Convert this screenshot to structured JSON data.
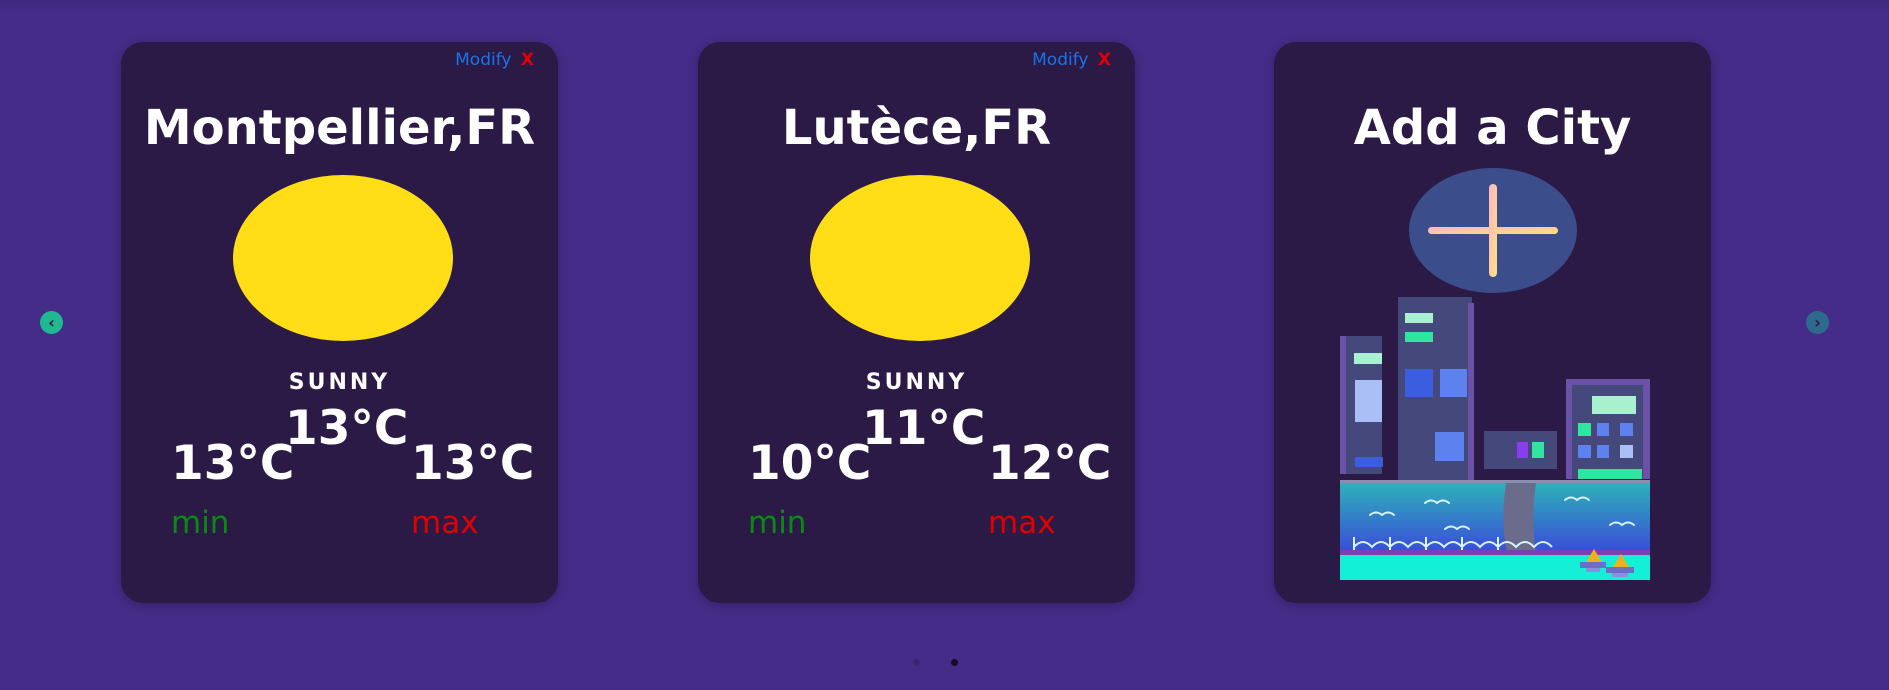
{
  "carousel": {
    "prev_icon": "chevron-left-icon",
    "next_icon": "chevron-right-icon",
    "pages": 2,
    "active_page": 2
  },
  "cards": [
    {
      "modify_label": "Modify",
      "close_label": "X",
      "city": "Montpellier,FR",
      "icon": "sun-icon",
      "condition": "SUNNY",
      "temp_current": "13°C",
      "temp_min": "13°C",
      "temp_max": "13°C",
      "min_label": "min",
      "max_label": "max"
    },
    {
      "modify_label": "Modify",
      "close_label": "X",
      "city": "Lutèce,FR",
      "icon": "sun-icon",
      "condition": "SUNNY",
      "temp_current": "11°C",
      "temp_min": "10°C",
      "temp_max": "12°C",
      "min_label": "min",
      "max_label": "max"
    }
  ],
  "add_card": {
    "title": "Add a City",
    "icon": "plus-icon",
    "illustration": "city-skyline-illustration"
  },
  "colors": {
    "background": "#452c88",
    "card": "#2b1a45",
    "sun": "#ffdd17",
    "modify": "#1a73e8",
    "close": "#e00000",
    "min": "#0a8a14",
    "max": "#e00000"
  }
}
